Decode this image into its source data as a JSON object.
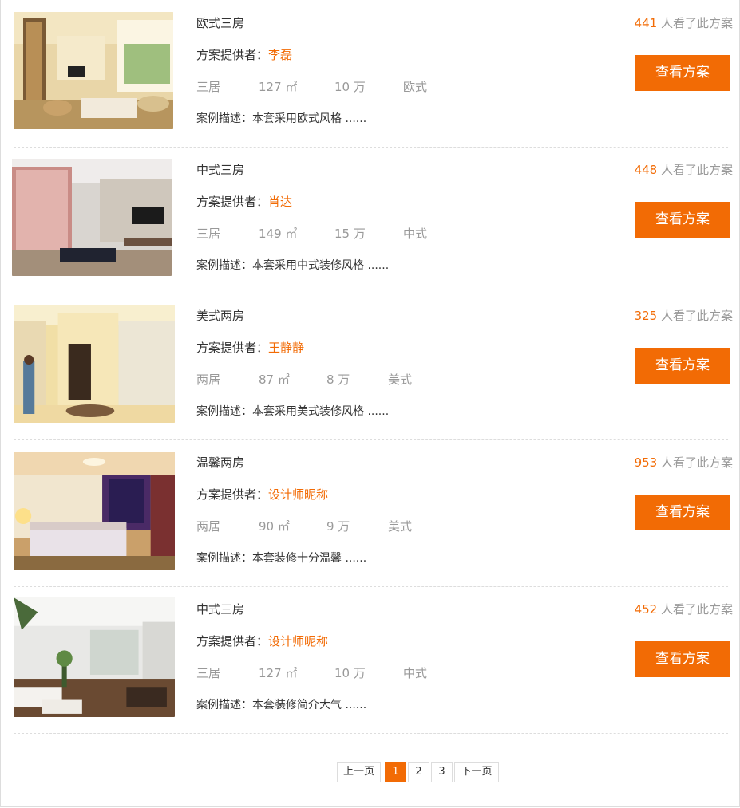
{
  "cases": [
    {
      "title": "欧式三房",
      "provider_label": "方案提供者：",
      "provider": "李磊",
      "rooms": "三居",
      "area": "127 ㎡",
      "budget": "10 万",
      "style": "欧式",
      "desc_label": "案例描述：",
      "desc": "本套采用欧式风格 ......",
      "views_num": "441",
      "views_text": " 人看了此方案",
      "button": "查看方案",
      "thumb": "living-room-european"
    },
    {
      "title": "中式三房",
      "provider_label": "方案提供者：",
      "provider": "肖达",
      "rooms": "三居",
      "area": "149 ㎡",
      "budget": "15 万",
      "style": "中式",
      "desc_label": "案例描述：",
      "desc": "本套采用中式装修风格 ......",
      "views_num": "448",
      "views_text": " 人看了此方案",
      "button": "查看方案",
      "thumb": "living-room-chinese"
    },
    {
      "title": "美式两房",
      "provider_label": "方案提供者：",
      "provider": "王静静",
      "rooms": "两居",
      "area": "87 ㎡",
      "budget": "8 万",
      "style": "美式",
      "desc_label": "案例描述：",
      "desc": "本套采用美式装修风格 ......",
      "views_num": "325",
      "views_text": " 人看了此方案",
      "button": "查看方案",
      "thumb": "hallway-american"
    },
    {
      "title": "温馨两房",
      "provider_label": "方案提供者：",
      "provider": "设计师昵称",
      "rooms": "两居",
      "area": "90 ㎡",
      "budget": "9 万",
      "style": "美式",
      "desc_label": "案例描述：",
      "desc": "本套装修十分温馨 ......",
      "views_num": "953",
      "views_text": " 人看了此方案",
      "button": "查看方案",
      "thumb": "bedroom-warm"
    },
    {
      "title": "中式三房",
      "provider_label": "方案提供者：",
      "provider": "设计师昵称",
      "rooms": "三居",
      "area": "127 ㎡",
      "budget": "10 万",
      "style": "中式",
      "desc_label": "案例描述：",
      "desc": "本套装修简介大气 ......",
      "views_num": "452",
      "views_text": " 人看了此方案",
      "button": "查看方案",
      "thumb": "living-room-modern"
    }
  ],
  "pagination": {
    "prev": "上一页",
    "pages": [
      "1",
      "2",
      "3"
    ],
    "current": "1",
    "next": "下一页"
  },
  "colors": {
    "accent": "#f26b05",
    "muted": "#999999",
    "text": "#333333",
    "divider": "#dddddd"
  }
}
